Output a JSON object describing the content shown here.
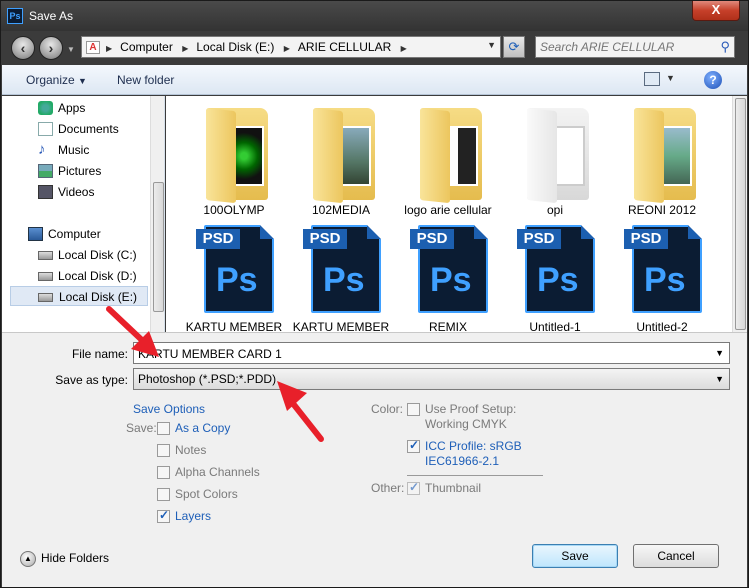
{
  "window": {
    "title": "Save As",
    "app_icon": "Ps",
    "close_glyph": "X"
  },
  "navigation": {
    "back_icon": "back-arrow-icon",
    "forward_icon": "forward-arrow-icon",
    "breadcrumbs": [
      "Computer",
      "Local Disk (E:)",
      "ARIE CELLULAR"
    ],
    "search_placeholder": "Search ARIE CELLULAR"
  },
  "toolbar": {
    "organize_label": "Organize",
    "new_folder_label": "New folder",
    "help_glyph": "?"
  },
  "sidebar": {
    "items": [
      {
        "label": "Apps",
        "icon": "apps-icon"
      },
      {
        "label": "Documents",
        "icon": "documents-icon"
      },
      {
        "label": "Music",
        "icon": "music-icon"
      },
      {
        "label": "Pictures",
        "icon": "pictures-icon"
      },
      {
        "label": "Videos",
        "icon": "videos-icon"
      },
      {
        "label": "Computer",
        "icon": "computer-icon"
      },
      {
        "label": "Local Disk (C:)",
        "icon": "drive-icon"
      },
      {
        "label": "Local Disk (D:)",
        "icon": "drive-icon"
      },
      {
        "label": "Local Disk (E:)",
        "icon": "drive-icon",
        "selected": true
      }
    ]
  },
  "files": [
    {
      "name": "100OLYMP",
      "type": "folder"
    },
    {
      "name": "102MEDIA",
      "type": "folder"
    },
    {
      "name": "logo arie cellular",
      "type": "folder"
    },
    {
      "name": "opi",
      "type": "folder"
    },
    {
      "name": "REONI 2012",
      "type": "folder"
    },
    {
      "name": "KARTU MEMBER",
      "type": "psd"
    },
    {
      "name": "KARTU MEMBER",
      "type": "psd"
    },
    {
      "name": "REMIX",
      "type": "psd"
    },
    {
      "name": "Untitled-1",
      "type": "psd"
    },
    {
      "name": "Untitled-2",
      "type": "psd"
    }
  ],
  "psd_icon": {
    "tag": "PSD",
    "mark": "Ps"
  },
  "form": {
    "file_name_label": "File name:",
    "file_name_value": "KARTU MEMBER CARD 1",
    "save_as_type_label": "Save as type:",
    "save_as_type_value": "Photoshop (*.PSD;*.PDD)"
  },
  "save_options": {
    "title": "Save Options",
    "save_label": "Save:",
    "items": [
      {
        "label": "As a Copy",
        "checked": false,
        "enabled": true
      },
      {
        "label": "Notes",
        "checked": false,
        "enabled": false
      },
      {
        "label": "Alpha Channels",
        "checked": false,
        "enabled": false
      },
      {
        "label": "Spot Colors",
        "checked": false,
        "enabled": false
      },
      {
        "label": "Layers",
        "checked": true,
        "enabled": true
      }
    ],
    "color_label": "Color:",
    "proof_line1": "Use Proof Setup:",
    "proof_line2": "Working CMYK",
    "icc_line1": "ICC Profile:  sRGB",
    "icc_line2": "IEC61966-2.1",
    "other_label": "Other:",
    "thumbnail_label": "Thumbnail"
  },
  "footer": {
    "hide_folders_label": "Hide Folders",
    "save_button": "Save",
    "cancel_button": "Cancel"
  },
  "colors": {
    "accent": "#1e5fb8",
    "annotation_arrow": "#e8202a"
  }
}
